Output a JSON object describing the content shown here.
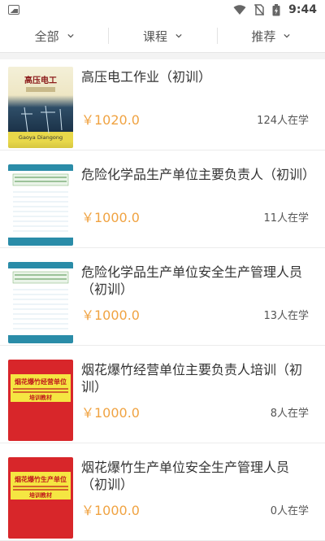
{
  "status_bar": {
    "time": "9:44",
    "icons": [
      "image-icon",
      "wifi-icon",
      "no-sim-icon",
      "battery-icon"
    ]
  },
  "filters": [
    {
      "label": "全部"
    },
    {
      "label": "课程"
    },
    {
      "label": "推荐"
    }
  ],
  "colors": {
    "price": "#f0a342",
    "divider": "#e6e6e6",
    "separator_bg": "#f3f3f3"
  },
  "courses": [
    {
      "title": "高压电工作业（初训）",
      "price": "￥1020.0",
      "learners": "124人在学",
      "cover": {
        "style": "electric",
        "text_top": "高压电工",
        "text_sub": "Gaoya Diangong"
      }
    },
    {
      "title": "危险化学品生产单位主要负责人（初训）",
      "price": "￥1000.0",
      "learners": "11人在学",
      "cover": {
        "style": "chemical"
      }
    },
    {
      "title": "危险化学品生产单位安全生产管理人员（初训）",
      "price": "￥1000.0",
      "learners": "13人在学",
      "cover": {
        "style": "chemical"
      }
    },
    {
      "title": "烟花爆竹经营单位主要负责人培训（初训）",
      "price": "￥1000.0",
      "learners": "8人在学",
      "cover": {
        "style": "fireworks",
        "text_top": "烟花爆竹经营单位",
        "text_bottom": "培训教材"
      }
    },
    {
      "title": "烟花爆竹生产单位安全生产管理人员（初训）",
      "price": "￥1000.0",
      "learners": "0人在学",
      "cover": {
        "style": "fireworks",
        "text_top": "烟花爆竹生产单位",
        "text_bottom": "培训教材"
      }
    }
  ]
}
